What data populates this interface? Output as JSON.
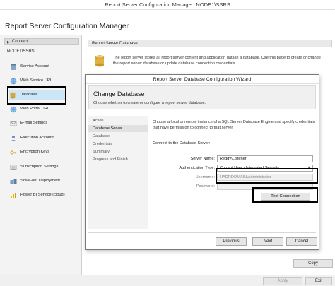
{
  "window": {
    "title": "Report Server Configuration Manager: NODE1\\SSRS"
  },
  "app": {
    "title": "Report Server Configuration Manager"
  },
  "sidebar": {
    "connect_label": "Connect",
    "server_node": "NODE1\\SSRS",
    "items": [
      {
        "label": "Service Account",
        "icon": "service-account-icon"
      },
      {
        "label": "Web Service URL",
        "icon": "globe-icon"
      },
      {
        "label": "Database",
        "icon": "database-icon"
      },
      {
        "label": "Web Portal URL",
        "icon": "globe-icon"
      },
      {
        "label": "E-mail Settings",
        "icon": "email-icon"
      },
      {
        "label": "Execution Account",
        "icon": "execution-account-icon"
      },
      {
        "label": "Encryption Keys",
        "icon": "key-icon"
      },
      {
        "label": "Subscription Settings",
        "icon": "subscription-icon"
      },
      {
        "label": "Scale-out Deployment",
        "icon": "scale-out-icon"
      },
      {
        "label": "Power BI Service (cloud)",
        "icon": "power-bi-icon"
      }
    ],
    "selected": "Database"
  },
  "main": {
    "section_title": "Report Server Database",
    "description": "The report server stores all report server content and application data in a database. Use this page to create or change the report server database or update database connection credentials.",
    "copy_label": "Copy"
  },
  "footer": {
    "apply_label": "Apply",
    "exit_label": "Exit"
  },
  "wizard": {
    "title": "Report Server Database Configuration Wizard",
    "header": "Change Database",
    "subtitle": "Choose whether to create or configure a report server database.",
    "steps": [
      "Action",
      "Database Server",
      "Database",
      "Credentials",
      "Summary",
      "Progress and Finish"
    ],
    "selected_step": "Database Server",
    "description": "Choose a local or remote instance of a SQL Server Database Engine and specify credentials that have permission to connect to that server.",
    "connect_label": "Connect to the Database Server:",
    "server_name_label": "Server Name:",
    "server_name_value": "Reddy\\Listener",
    "auth_label": "Authentication Type:",
    "auth_value": "Current User - Integrated Security",
    "username_label": "Username:",
    "username_value": "HADRDOMAIN\\Administrator",
    "password_label": "Password:",
    "password_value": "",
    "test_connection_label": "Test Connection",
    "previous_label": "Previous",
    "next_label": "Next",
    "cancel_label": "Cancel"
  },
  "colors": {
    "selected_nav": "#cde6f7",
    "annotation_box": "#000000"
  }
}
